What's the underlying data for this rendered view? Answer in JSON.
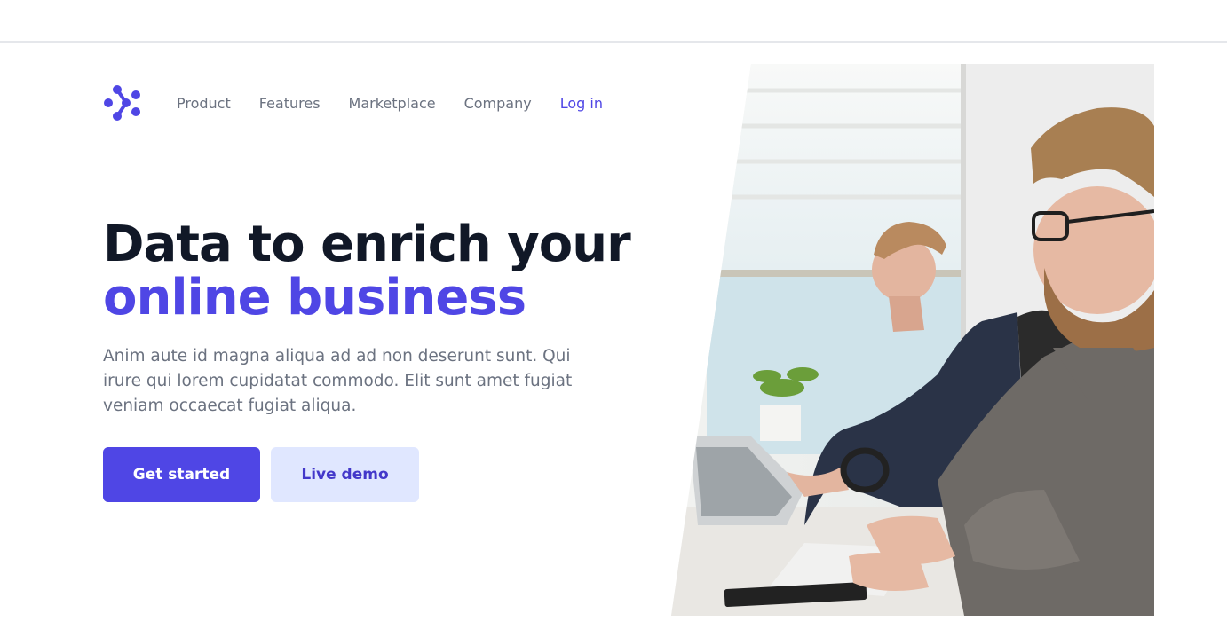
{
  "nav": {
    "logo": "logo-icon",
    "links": [
      "Product",
      "Features",
      "Marketplace",
      "Company"
    ],
    "login": "Log in"
  },
  "hero": {
    "headline_line1": "Data to enrich your",
    "headline_line2": "online business",
    "description": "Anim aute id magna aliqua ad ad non deserunt sunt. Qui irure qui lorem cupidatat commodo. Elit sunt amet fugiat veniam occaecat fugiat aliqua.",
    "cta_primary": "Get started",
    "cta_secondary": "Live demo"
  },
  "colors": {
    "brand": "#4f46e5",
    "heading": "#111827",
    "body_text": "#6b7280",
    "secondary_button_bg": "#e0e7ff",
    "secondary_button_text": "#4338ca"
  }
}
